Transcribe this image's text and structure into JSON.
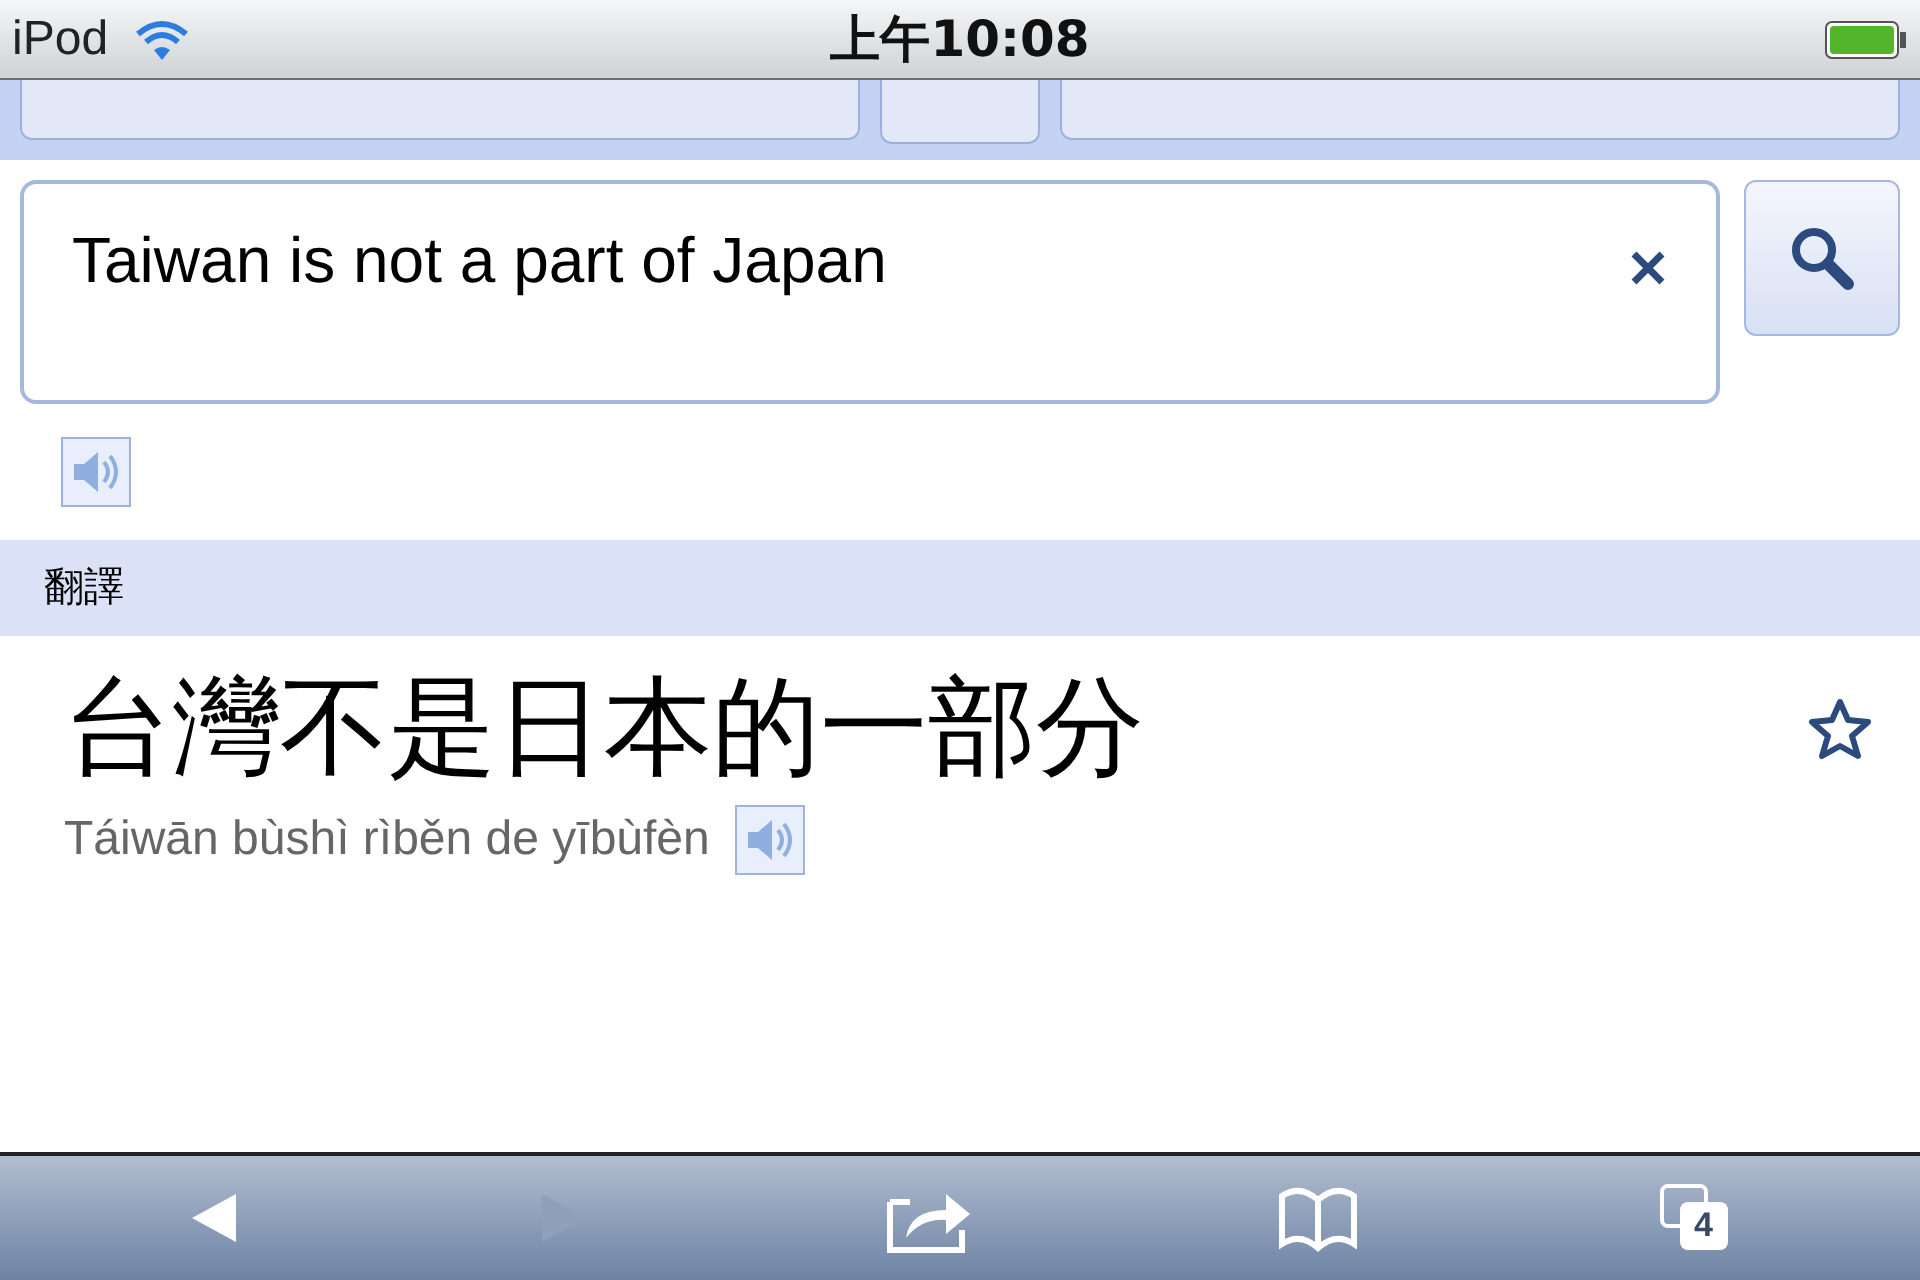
{
  "status_bar": {
    "carrier": "iPod",
    "time": "上午10:08"
  },
  "input": {
    "value": "Taiwan is not a part of Japan"
  },
  "section_header": "翻譯",
  "translation": {
    "text": "台灣不是日本的一部分",
    "romanization": "Táiwān bùshì rìběn de yībùfèn"
  },
  "toolbar": [
    {
      "kind": "back",
      "disabled": false
    },
    {
      "kind": "forward",
      "disabled": true
    },
    {
      "kind": "share",
      "disabled": false
    },
    {
      "kind": "bookmarks",
      "disabled": false
    },
    {
      "kind": "tabs",
      "disabled": false,
      "count": "4"
    }
  ]
}
